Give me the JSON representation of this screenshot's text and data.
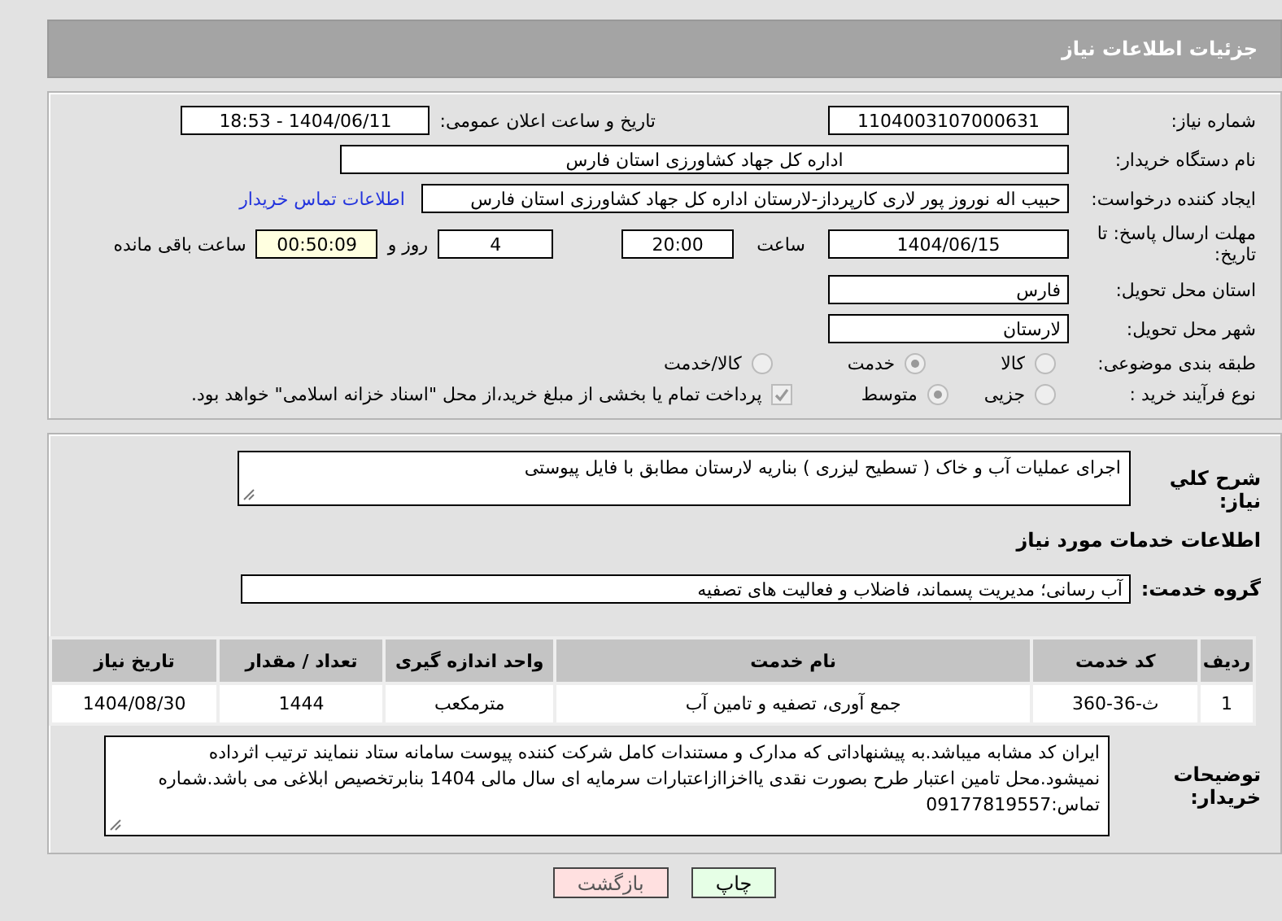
{
  "title": "جزئیات اطلاعات نیاز",
  "rows": [
    {
      "kind": "pair",
      "label": "شماره نیاز:",
      "value": "1104003107000631",
      "label2": "تاریخ و ساعت اعلان عمومی:",
      "value2": "1404/06/11 - 18:53"
    },
    {
      "kind": "long",
      "label": "نام دستگاه خریدار:",
      "value": "اداره کل جهاد کشاورزی استان فارس"
    },
    {
      "kind": "contact",
      "label": "ایجاد کننده درخواست:",
      "value": "حبیب اله  نوروز پور لاری کارپرداز-لارستان اداره کل جهاد کشاورزی استان فارس",
      "link": "اطلاعات تماس خریدار"
    },
    {
      "kind": "deadline",
      "label": "مهلت ارسال پاسخ: تا تاریخ:",
      "date": "1404/06/15",
      "time_label": "ساعت",
      "time": "20:00",
      "days": "4",
      "days_label": "روز و",
      "remaining": "00:50:09",
      "remaining_label": "ساعت باقی مانده"
    },
    {
      "kind": "short",
      "label": "استان محل تحویل:",
      "value": "فارس"
    },
    {
      "kind": "short",
      "label": "شهر محل تحویل:",
      "value": "لارستان"
    },
    {
      "kind": "radios",
      "label": "طبقه بندی موضوعی:",
      "options": [
        {
          "label": "کالا",
          "selected": false
        },
        {
          "label": "خدمت",
          "selected": true
        },
        {
          "label": "کالا/خدمت",
          "selected": false
        }
      ]
    },
    {
      "kind": "purchase",
      "label": "نوع فرآیند خرید :",
      "options": [
        {
          "label": "جزیی",
          "selected": false
        },
        {
          "label": "متوسط",
          "selected": true
        }
      ],
      "note": {
        "label": "پرداخت تمام یا بخشی از مبلغ خرید،از محل \"اسناد خزانه اسلامی\" خواهد بود.",
        "checked": true
      }
    }
  ],
  "description": {
    "label": "شرح کلي نياز:",
    "value": "اجرای عملیات آب و خاک ( تسطیح لیزری ) بناریه لارستان مطابق با فایل پیوستی"
  },
  "services_title": "اطلاعات خدمات مورد نیاز",
  "service_group": {
    "label": "گروه خدمت:",
    "value": "آب رسانی؛ مدیریت پسماند، فاضلاب و فعالیت های تصفیه"
  },
  "table": {
    "columns": [
      "ردیف",
      "کد خدمت",
      "نام خدمت",
      "واحد اندازه گیری",
      "تعداد / مقدار",
      "تاریخ نیاز"
    ],
    "rows": [
      [
        "1",
        "ث-36-360",
        "جمع آوری، تصفیه و تامین آب",
        "مترمکعب",
        "1444",
        "1404/08/30"
      ]
    ]
  },
  "buyer_notes": {
    "label": "توضیحات خریدار:",
    "value": "ایران کد مشابه میباشد.به پیشنهاداتی که مدارک و مستندات کامل شرکت کننده پیوست سامانه ستاد ننمایند ترتیب اثرداده نمیشود.محل تامین اعتبار طرح بصورت نقدی یااخزاازاعتبارات سرمایه ای سال مالی 1404 بنابرتخصیص ابلاغی می باشد.شماره تماس:09177819557"
  },
  "buttons": [
    {
      "label": "چاپ",
      "kind": "print"
    },
    {
      "label": "بازگشت",
      "kind": "back"
    }
  ]
}
